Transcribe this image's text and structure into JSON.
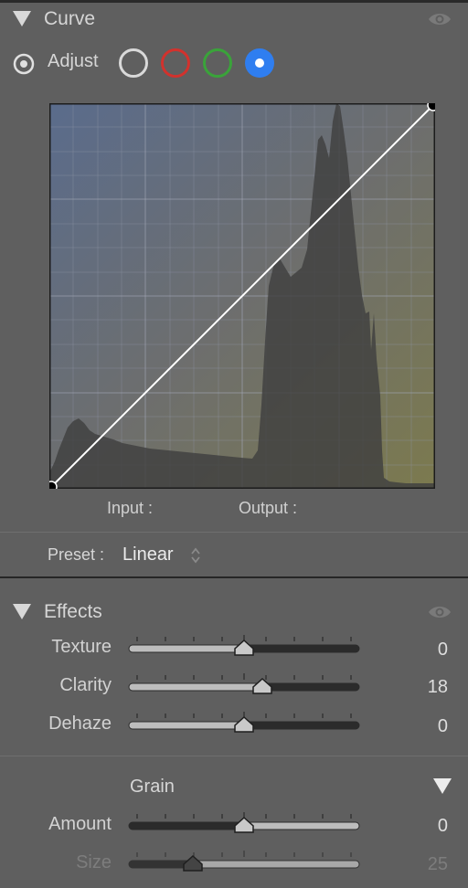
{
  "curve_section": {
    "title": "Curve",
    "adjust_label": "Adjust",
    "channels": [
      "white",
      "red",
      "green",
      "blue"
    ],
    "active_channel": "blue",
    "input_label": "Input :",
    "output_label": "Output :",
    "preset_label": "Preset :",
    "preset_value": "Linear"
  },
  "effects_section": {
    "title": "Effects",
    "sliders": [
      {
        "label": "Texture",
        "value": "0"
      },
      {
        "label": "Clarity",
        "value": "18"
      },
      {
        "label": "Dehaze",
        "value": "0"
      }
    ]
  },
  "grain_section": {
    "title": "Grain",
    "sliders": [
      {
        "label": "Amount",
        "value": "0"
      },
      {
        "label": "Size",
        "value": "25"
      }
    ]
  },
  "colors": {
    "panel_bg": "#5f5f5f",
    "active_channel_blue": "#2f7ef0",
    "red_channel": "#d2322d",
    "green_channel": "#3aa33a"
  },
  "icons": [
    "disclosure-triangle-icon",
    "eye-icon",
    "target-adjust-icon",
    "updown-arrows-icon"
  ]
}
